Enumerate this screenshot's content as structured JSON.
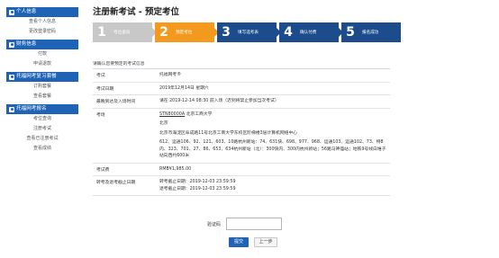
{
  "sidebar": {
    "sections": [
      {
        "title": "个人信息",
        "items": [
          "查看个人信息",
          "更改登录密码"
        ]
      },
      {
        "title": "财务信息",
        "items": [
          "付款",
          "申请退款"
        ]
      },
      {
        "title": "托福网考复习套餐",
        "items": [
          "订购套餐",
          "查看套餐"
        ]
      },
      {
        "title": "托福网考报名",
        "items": [
          "考位查询",
          "注册考试",
          "查看已注册考试",
          "查看成绩"
        ]
      }
    ]
  },
  "page": {
    "title": "注册新考试 - 预定考位"
  },
  "steps": [
    {
      "num": "1",
      "label": "考位查询",
      "state": "done"
    },
    {
      "num": "2",
      "label": "预定考位",
      "state": "active"
    },
    {
      "num": "3",
      "label": "填写选考表",
      "state": "todo"
    },
    {
      "num": "4",
      "label": "确认付费",
      "state": "todo"
    },
    {
      "num": "5",
      "label": "报名成功",
      "state": "todo"
    }
  ],
  "notice": "请确认您要预定的考试信息",
  "exam": {
    "exam_label": "考试",
    "exam_value": "托福网考®",
    "date_label": "考试日期",
    "date_value": "2019年12月14日 星期六",
    "arrival_label": "最晚到达及入场时间",
    "arrival_value": "请在 2019-12-14 08:30 前入场（迟到将禁止参加当次考试）",
    "venue_label": "考场",
    "venue_code": "STN80000A",
    "venue_name": "北京工商大学",
    "venue_city": "北京",
    "venue_address": "北京市海淀区阜成路11号北京工商大学东校区阶梯楼3层计算机网络中心",
    "venue_bus": "612、运通106、92、121、603、10路杭州新站：74、631快、698、977、968、运通103、运通102、73、特8内、323、701、27、86、653、634杭州新站（北）：300快内、300内杭州新站；56路马神庙站；地铁9号线白堆子站向西约600米",
    "fee_label": "考试费",
    "fee_value": "RMB¥1,985.00",
    "deadline_label": "转考及退考截止日期",
    "transfer_deadline": "转考截止日期：2019-12-03 23:59:59",
    "refund_deadline": "退考截止日期：2019-12-03 23:59:59"
  },
  "form": {
    "captcha_label": "验证码",
    "captcha_value": "",
    "submit_label": "提交",
    "back_label": "上一步"
  }
}
